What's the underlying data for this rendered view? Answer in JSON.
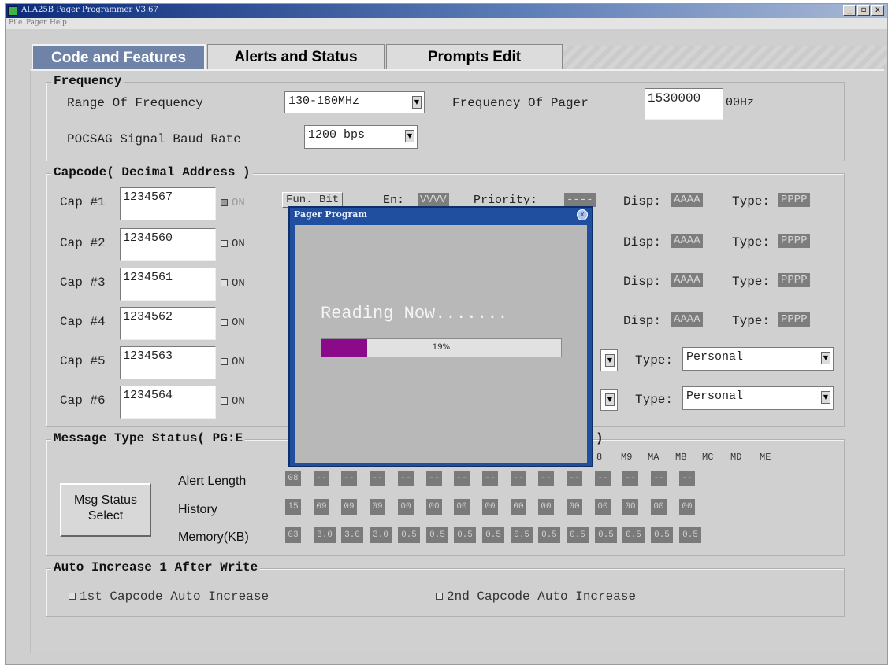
{
  "window": {
    "title": "ALA25B Pager Programmer V3.67",
    "controls": [
      "_",
      "▫",
      "x"
    ]
  },
  "menu": [
    "File",
    "Pager",
    "Help"
  ],
  "tabs": [
    {
      "label": "Code and Features",
      "active": true
    },
    {
      "label": "Alerts and Status",
      "active": false
    },
    {
      "label": "Prompts Edit",
      "active": false
    }
  ],
  "frequency": {
    "legend": "Frequency",
    "range_label": "Range Of Frequency",
    "range_value": "130-180MHz",
    "pager_freq_label": "Frequency Of Pager",
    "pager_freq_value": "1530000",
    "pager_freq_unit": "00Hz",
    "baud_label": "POCSAG Signal Baud Rate",
    "baud_value": "1200 bps"
  },
  "capcode": {
    "legend": "Capcode( Decimal Address )",
    "on_label": "ON",
    "fun_bit_label": "Fun. Bit",
    "en_label": "En:",
    "en_value": "VVVV",
    "priority_label": "Priority:",
    "priority_value": "----",
    "disp_label": "Disp:",
    "disp_value": "AAAA",
    "type_label": "Type:",
    "type_value": "PPPP",
    "type_select_value": "Personal",
    "rows": [
      {
        "label": "Cap #1",
        "value": "1234567",
        "on": true
      },
      {
        "label": "Cap #2",
        "value": "1234560",
        "on": false
      },
      {
        "label": "Cap #3",
        "value": "1234561",
        "on": false
      },
      {
        "label": "Cap #4",
        "value": "1234562",
        "on": false
      },
      {
        "label": "Cap #5",
        "value": "1234563",
        "on": false
      },
      {
        "label": "Cap #6",
        "value": "1234564",
        "on": false
      }
    ]
  },
  "message": {
    "legend": "Message Type Status( PG:E",
    "legend_tail": ")",
    "button_label": "Msg Status Select",
    "row_labels": [
      "Alert Length",
      "History",
      "Memory(KB)"
    ],
    "columns": [
      "8",
      "M9",
      "MA",
      "MB",
      "MC",
      "MD",
      "ME"
    ],
    "alert_length": [
      "08",
      "--",
      "--",
      "--",
      "--",
      "--",
      "--",
      "--",
      "--",
      "--",
      "--",
      "--",
      "--",
      "--",
      "--"
    ],
    "history": [
      "15",
      "09",
      "09",
      "09",
      "00",
      "00",
      "00",
      "00",
      "00",
      "00",
      "00",
      "00",
      "00",
      "00",
      "00"
    ],
    "memory": [
      "03",
      "3.0",
      "3.0",
      "3.0",
      "0.5",
      "0.5",
      "0.5",
      "0.5",
      "0.5",
      "0.5",
      "0.5",
      "0.5",
      "0.5",
      "0.5",
      "0.5"
    ]
  },
  "auto_increase": {
    "legend": "Auto Increase 1 After Write",
    "first": "1st Capcode Auto Increase",
    "second": "2nd Capcode Auto Increase"
  },
  "dialog": {
    "title": "Pager Program",
    "status": "Reading Now.......",
    "progress_percent": 19,
    "progress_text": "19%"
  },
  "colors": {
    "title_bar": "#0b2a7a",
    "active_tab": "#6f82a8",
    "dialog_frame": "#1f4f9e",
    "progress_fill": "#8a0a8a"
  }
}
